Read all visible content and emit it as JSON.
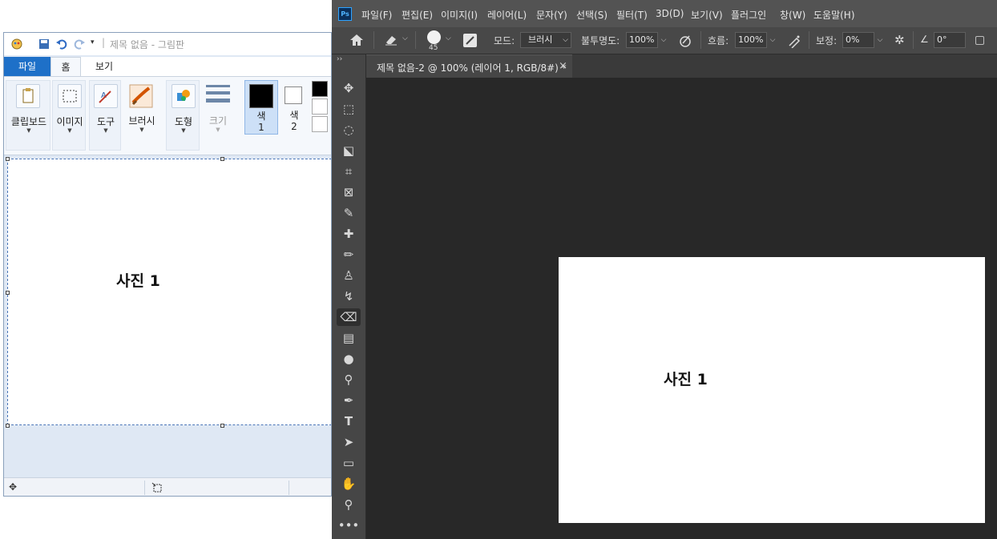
{
  "paint": {
    "title": "제목 없음 - 그림판",
    "tabs": [
      "파일",
      "홈",
      "보기"
    ],
    "groups": {
      "clipboard": "클립보드",
      "image": "이미지",
      "tools": "도구",
      "brushes": "브러시",
      "shapes": "도형",
      "size": "크기",
      "color1": "색\n1",
      "color2": "색\n2"
    },
    "canvas_text": "사진 1"
  },
  "photoshop": {
    "menu": [
      "파일(F)",
      "편집(E)",
      "이미지(I)",
      "레이어(L)",
      "문자(Y)",
      "선택(S)",
      "필터(T)",
      "3D(D)",
      "보기(V)",
      "플러그인",
      "창(W)",
      "도움말(H)"
    ],
    "options": {
      "brush_size": "45",
      "mode_label": "모드:",
      "mode_value": "브러시",
      "opacity_label": "불투명도:",
      "opacity_value": "100%",
      "flow_label": "흐름:",
      "flow_value": "100%",
      "smoothing_label": "보정:",
      "smoothing_value": "0%",
      "angle_value": "0°"
    },
    "doc_tab": "제목 없음-2 @ 100% (레이어 1, RGB/8#) *",
    "canvas_text": "사진 1"
  },
  "colors": {
    "ps_bg": "#282828",
    "ps_panel": "#464646",
    "paint_accent": "#1e70c8"
  }
}
